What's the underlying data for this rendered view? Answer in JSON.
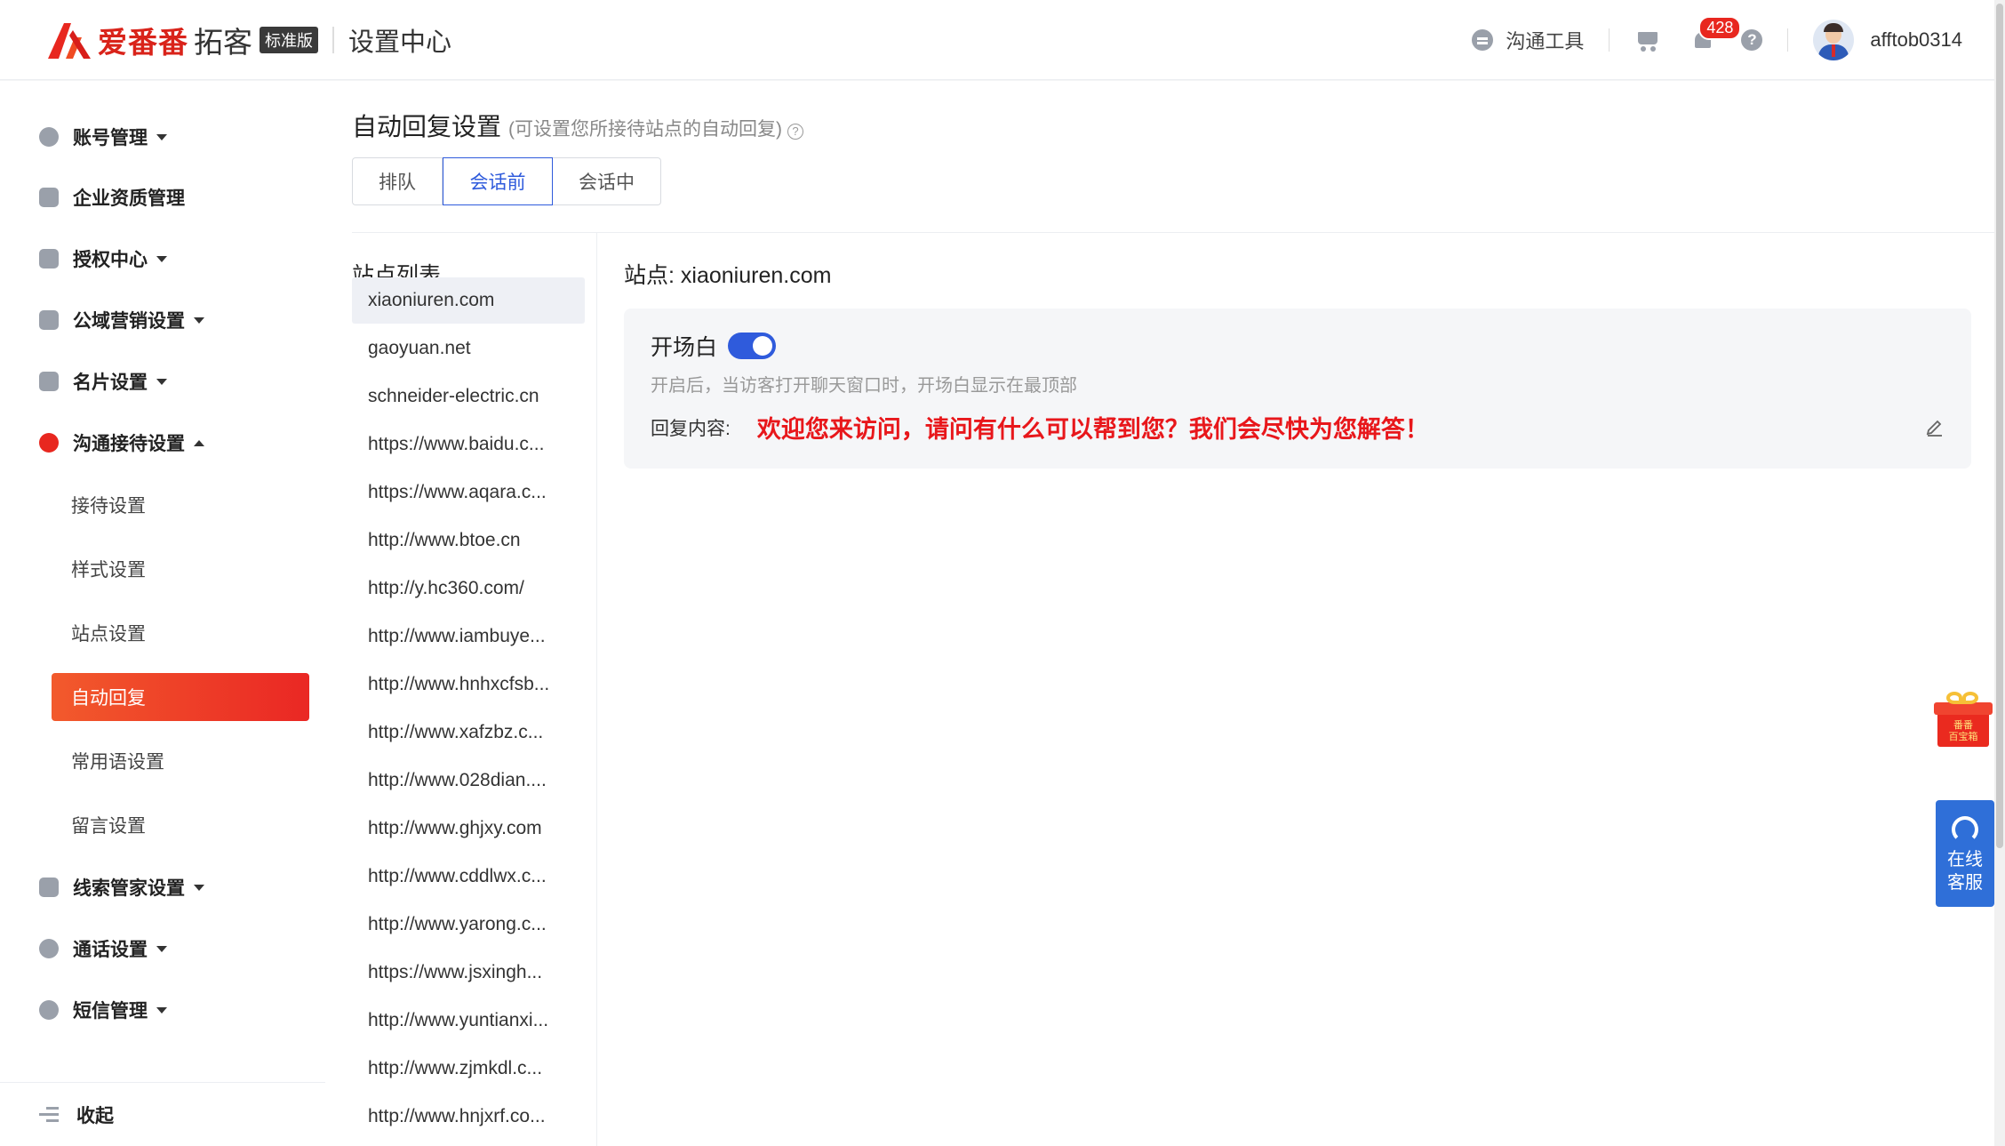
{
  "header": {
    "brand_name": "爱番番",
    "brand_sub": "拓客",
    "brand_badge": "标准版",
    "title": "设置中心",
    "tools_label": "沟通工具",
    "notification_count": "428",
    "help_label": "?",
    "username": "afftob0314"
  },
  "sidebar": {
    "items": [
      {
        "label": "账号管理",
        "icon": "account-icon"
      },
      {
        "label": "企业资质管理",
        "icon": "company-icon"
      },
      {
        "label": "授权中心",
        "icon": "lock-icon"
      },
      {
        "label": "公域营销设置",
        "icon": "chart-icon"
      },
      {
        "label": "名片设置",
        "icon": "card-icon"
      },
      {
        "label": "沟通接待设置",
        "icon": "chat-icon"
      }
    ],
    "sub_items": [
      "接待设置",
      "样式设置",
      "站点设置",
      "自动回复",
      "常用语设置",
      "留言设置"
    ],
    "items_after": [
      {
        "label": "线索管家设置",
        "icon": "leads-icon"
      },
      {
        "label": "通话设置",
        "icon": "phone-icon"
      },
      {
        "label": "短信管理",
        "icon": "sms-icon"
      }
    ],
    "collapse_label": "收起"
  },
  "main": {
    "title": "自动回复设置",
    "title_hint": "(可设置您所接待站点的自动回复)",
    "tabs": [
      "排队",
      "会话前",
      "会话中"
    ],
    "active_tab": "会话前",
    "site_list_title": "站点列表",
    "sites": [
      "xiaoniuren.com",
      "gaoyuan.net",
      "schneider-electric.cn",
      "https://www.baidu.c...",
      "https://www.aqara.c...",
      "http://www.btoe.cn",
      "http://y.hc360.com/",
      "http://www.iambuye...",
      "http://www.hnhxcfsb...",
      "http://www.xafzbz.c...",
      "http://www.028dian....",
      "http://www.ghjxy.com",
      "http://www.cddlwx.c...",
      "http://www.yarong.c...",
      "https://www.jsxingh...",
      "http://www.yuntianxi...",
      "http://www.zjmkdl.c...",
      "http://www.hnjxrf.co..."
    ],
    "detail_title": "站点: xiaoniuren.com",
    "opening_label": "开场白",
    "opening_enabled": true,
    "opening_desc": "开启后，当访客打开聊天窗口时，开场白显示在最顶部",
    "reply_label": "回复内容:",
    "reply_text": "欢迎您来访问，请问有什么可以帮到您？我们会尽快为您解答！"
  },
  "float": {
    "gift_label": "番番\n百宝箱",
    "service_line1": "在线",
    "service_line2": "客服"
  },
  "colors": {
    "brand_red": "#e8271f",
    "accent_blue": "#2f5bdc",
    "reply_red": "#e8171b"
  }
}
